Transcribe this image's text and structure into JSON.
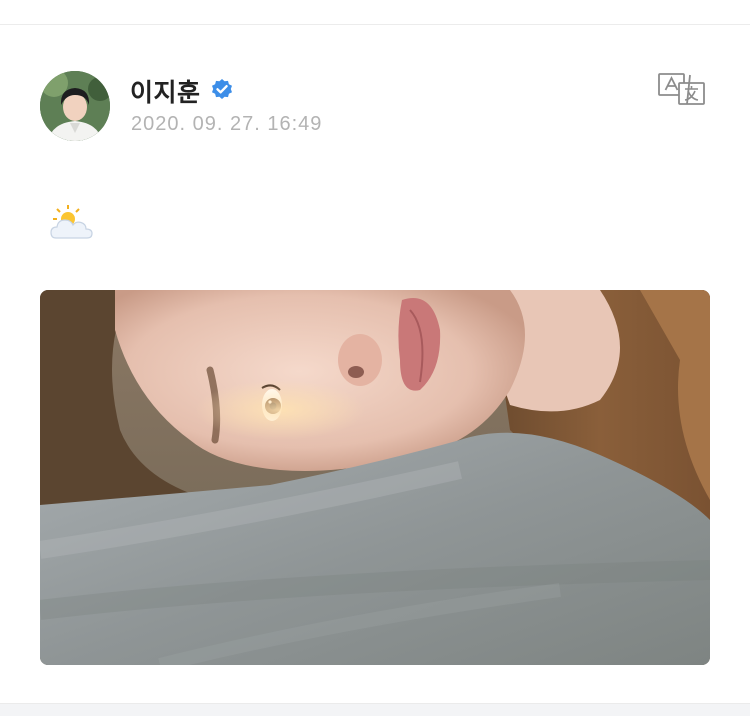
{
  "post": {
    "author": {
      "name": "이지훈",
      "verified": true,
      "verified_color": "#3d8ee8"
    },
    "timestamp": "2020. 09. 27. 16:49",
    "translate_icon": "translate-icon",
    "text_emoji": "sun-behind-cloud",
    "media": {
      "type": "photo"
    }
  },
  "colors": {
    "timestamp": "#b3b3b3",
    "name": "#222222",
    "divider": "#ececec"
  }
}
